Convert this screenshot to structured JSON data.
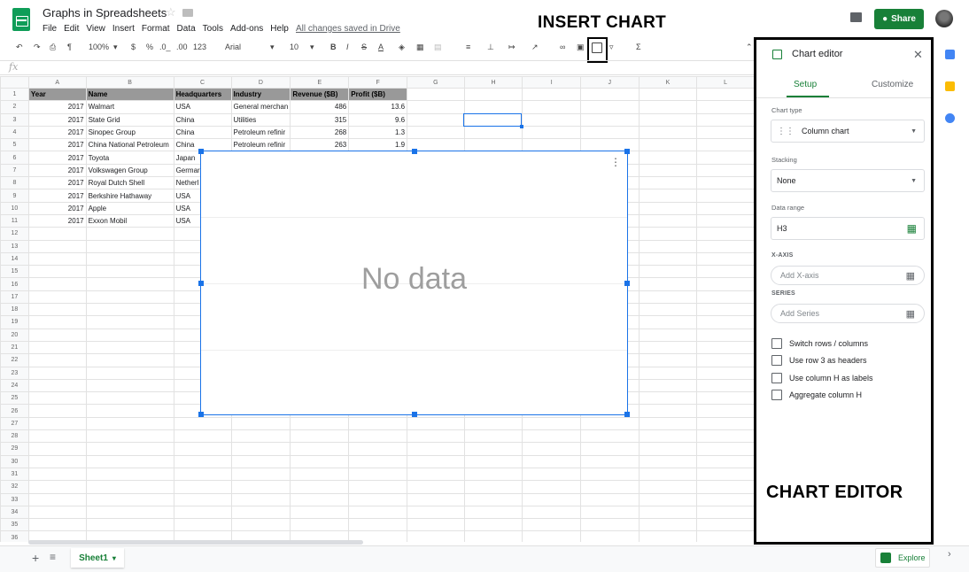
{
  "header": {
    "doc_title": "Graphs in Spreadsheets",
    "star_glyph": "☆",
    "menu": [
      "File",
      "Edit",
      "View",
      "Insert",
      "Format",
      "Data",
      "Tools",
      "Add-ons",
      "Help"
    ],
    "saved_status": "All changes saved in Drive",
    "share_label": "Share"
  },
  "annotations": {
    "insert_chart": "INSERT CHART",
    "chart_editor": "CHART EDITOR"
  },
  "toolbar": {
    "zoom": "100%",
    "currency": "$",
    "percent": "%",
    "dec_less": ".0_",
    "dec_more": ".00",
    "more_formats": "123",
    "font": "Arial",
    "font_size": "10",
    "bold": "B",
    "italic": "I",
    "strike": "S",
    "text_color": "A",
    "sum": "Σ"
  },
  "formula_bar": {
    "fx": "fx"
  },
  "sheet": {
    "col_headers": [
      "A",
      "B",
      "C",
      "D",
      "E",
      "F",
      "G",
      "H",
      "I",
      "J",
      "K",
      "L"
    ],
    "header_row": [
      "Year",
      "Name",
      "Headquarters",
      "Industry",
      "Revenue ($B)",
      "Profit ($B)"
    ],
    "rows": [
      [
        "2017",
        "Walmart",
        "USA",
        "General merchan",
        "486",
        "13.6"
      ],
      [
        "2017",
        "State Grid",
        "China",
        "Utilities",
        "315",
        "9.6"
      ],
      [
        "2017",
        "Sinopec Group",
        "China",
        "Petroleum refinir",
        "268",
        "1.3"
      ],
      [
        "2017",
        "China National Petroleum",
        "China",
        "Petroleum refinir",
        "263",
        "1.9"
      ],
      [
        "2017",
        "Toyota",
        "Japan",
        "",
        "",
        ""
      ],
      [
        "2017",
        "Volkswagen Group",
        "Germar",
        "",
        "",
        ""
      ],
      [
        "2017",
        "Royal Dutch Shell",
        "Netherl",
        "",
        "",
        ""
      ],
      [
        "2017",
        "Berkshire Hathaway",
        "USA",
        "",
        "",
        ""
      ],
      [
        "2017",
        "Apple",
        "USA",
        "",
        "",
        ""
      ],
      [
        "2017",
        "Exxon Mobil",
        "USA",
        "",
        "",
        ""
      ]
    ],
    "total_rows": 37
  },
  "chart": {
    "empty_message": "No data",
    "menu_glyph": "⋮"
  },
  "bottom": {
    "add_glyph": "+",
    "menu_glyph": "≡",
    "sheet_tab": "Sheet1",
    "explore_label": "Explore",
    "collapse_glyph": "›"
  },
  "editor": {
    "title": "Chart editor",
    "close_glyph": "✕",
    "tabs": {
      "setup": "Setup",
      "customize": "Customize"
    },
    "chart_type_label": "Chart type",
    "chart_type_value": "Column chart",
    "stacking_label": "Stacking",
    "stacking_value": "None",
    "data_range_label": "Data range",
    "data_range_value": "H3",
    "xaxis_label": "X-AXIS",
    "xaxis_placeholder": "Add X-axis",
    "series_label": "SERIES",
    "series_placeholder": "Add Series",
    "checkboxes": [
      "Switch rows / columns",
      "Use row 3 as headers",
      "Use column H as labels",
      "Aggregate column H"
    ]
  },
  "colors": {
    "brand_green": "#188038",
    "selection_blue": "#1a73e8"
  }
}
